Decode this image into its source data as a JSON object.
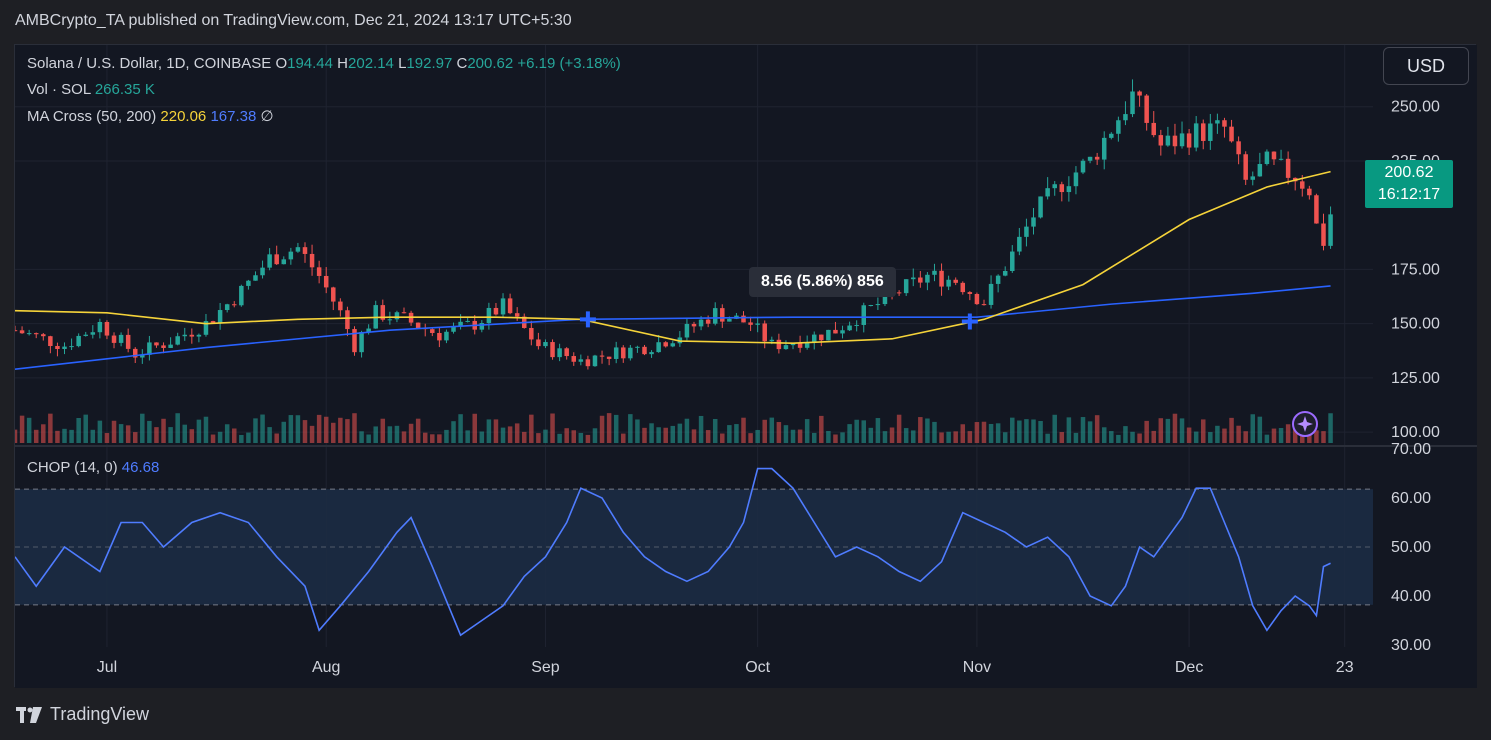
{
  "attribution": "AMBCrypto_TA published on TradingView.com, Dec 21, 2024 13:17 UTC+5:30",
  "legend": {
    "symbol": "Solana / U.S. Dollar, 1D, COINBASE",
    "o_label": "O",
    "o": "194.44",
    "h_label": "H",
    "h": "202.14",
    "l_label": "L",
    "l": "192.97",
    "c_label": "C",
    "c": "200.62",
    "change": "+6.19 (+3.18%)",
    "vol_label": "Vol · SOL",
    "vol": "266.35 K",
    "ma_label": "MA Cross (50, 200)",
    "ma50": "220.06",
    "ma200": "167.38",
    "ma_extra": "∅"
  },
  "currency_button": "USD",
  "price_badge": {
    "price": "200.62",
    "countdown": "16:12:17"
  },
  "measure_tooltip": "8.56 (5.86%) 856",
  "chop_legend": {
    "label": "CHOP (14, 0)",
    "value": "46.68"
  },
  "footer": {
    "brand": "TradingView"
  },
  "colors": {
    "bg": "#131722",
    "up": "#26a69a",
    "down": "#ef5350",
    "ma50": "#f5d33a",
    "ma200": "#2962ff",
    "chop": "#4f7cff",
    "chop_band": "#1c2b44"
  },
  "chart_data": [
    {
      "type": "candlestick",
      "title": "Solana / U.S. Dollar, 1D, COINBASE",
      "y_ticks": [
        "100.00",
        "125.00",
        "150.00",
        "175.00",
        "250.00",
        "225.00"
      ],
      "ylim": [
        95,
        260
      ],
      "x_ticks": [
        "Jul",
        "Aug",
        "Sep",
        "Oct",
        "Nov",
        "Dec",
        "23"
      ],
      "xlim": [
        "2024-06-18",
        "2024-12-27"
      ],
      "close_path": [
        [
          "2024-06-18",
          147
        ],
        [
          "2024-06-25",
          140
        ],
        [
          "2024-06-30",
          150
        ],
        [
          "2024-07-05",
          136
        ],
        [
          "2024-07-10",
          142
        ],
        [
          "2024-07-15",
          150
        ],
        [
          "2024-07-20",
          165
        ],
        [
          "2024-07-24",
          180
        ],
        [
          "2024-07-28",
          185
        ],
        [
          "2024-07-31",
          172
        ],
        [
          "2024-08-03",
          155
        ],
        [
          "2024-08-05",
          140
        ],
        [
          "2024-08-08",
          155
        ],
        [
          "2024-08-12",
          152
        ],
        [
          "2024-08-17",
          145
        ],
        [
          "2024-08-22",
          150
        ],
        [
          "2024-08-26",
          158
        ],
        [
          "2024-08-31",
          140
        ],
        [
          "2024-09-06",
          133
        ],
        [
          "2024-09-10",
          136
        ],
        [
          "2024-09-16",
          140
        ],
        [
          "2024-09-20",
          145
        ],
        [
          "2024-09-25",
          155
        ],
        [
          "2024-09-30",
          150
        ],
        [
          "2024-10-03",
          140
        ],
        [
          "2024-10-08",
          143
        ],
        [
          "2024-10-12",
          147
        ],
        [
          "2024-10-16",
          155
        ],
        [
          "2024-10-21",
          165
        ],
        [
          "2024-10-25",
          172
        ],
        [
          "2024-10-29",
          170
        ],
        [
          "2024-11-02",
          160
        ],
        [
          "2024-11-06",
          182
        ],
        [
          "2024-11-09",
          200
        ],
        [
          "2024-11-13",
          215
        ],
        [
          "2024-11-17",
          225
        ],
        [
          "2024-11-20",
          240
        ],
        [
          "2024-11-23",
          255
        ],
        [
          "2024-11-27",
          232
        ],
        [
          "2024-12-02",
          238
        ],
        [
          "2024-12-06",
          240
        ],
        [
          "2024-12-09",
          215
        ],
        [
          "2024-12-12",
          224
        ],
        [
          "2024-12-16",
          218
        ],
        [
          "2024-12-18",
          212
        ],
        [
          "2024-12-19",
          195
        ],
        [
          "2024-12-20",
          188
        ],
        [
          "2024-12-21",
          200.62
        ]
      ],
      "ma50_path": [
        [
          "2024-06-18",
          156
        ],
        [
          "2024-07-01",
          155
        ],
        [
          "2024-07-15",
          150
        ],
        [
          "2024-07-28",
          152
        ],
        [
          "2024-08-10",
          153
        ],
        [
          "2024-08-25",
          153
        ],
        [
          "2024-09-06",
          152
        ],
        [
          "2024-09-20",
          142
        ],
        [
          "2024-10-06",
          141
        ],
        [
          "2024-10-20",
          143
        ],
        [
          "2024-11-02",
          152
        ],
        [
          "2024-11-16",
          168
        ],
        [
          "2024-12-01",
          198
        ],
        [
          "2024-12-12",
          213
        ],
        [
          "2024-12-21",
          220.06
        ]
      ],
      "ma200_path": [
        [
          "2024-06-18",
          129
        ],
        [
          "2024-07-15",
          139
        ],
        [
          "2024-08-10",
          147
        ],
        [
          "2024-09-06",
          152
        ],
        [
          "2024-10-06",
          153
        ],
        [
          "2024-11-01",
          153
        ],
        [
          "2024-11-20",
          159
        ],
        [
          "2024-12-10",
          164
        ],
        [
          "2024-12-21",
          167.38
        ]
      ],
      "cross_markers": [
        [
          "2024-09-07",
          152
        ],
        [
          "2024-10-31",
          151
        ]
      ]
    },
    {
      "type": "line",
      "title": "CHOP (14, 0)",
      "y_ticks": [
        "70.00",
        "60.00",
        "50.00",
        "40.00",
        "30.00"
      ],
      "ylim": [
        30,
        70
      ],
      "band": [
        38.2,
        61.8
      ],
      "values": [
        [
          "2024-06-18",
          48
        ],
        [
          "2024-06-21",
          42
        ],
        [
          "2024-06-25",
          50
        ],
        [
          "2024-06-30",
          45
        ],
        [
          "2024-07-03",
          55
        ],
        [
          "2024-07-06",
          55
        ],
        [
          "2024-07-09",
          50
        ],
        [
          "2024-07-13",
          55
        ],
        [
          "2024-07-17",
          57
        ],
        [
          "2024-07-21",
          55
        ],
        [
          "2024-07-25",
          48
        ],
        [
          "2024-07-29",
          42
        ],
        [
          "2024-07-31",
          33
        ],
        [
          "2024-08-03",
          38
        ],
        [
          "2024-08-07",
          45
        ],
        [
          "2024-08-11",
          53
        ],
        [
          "2024-08-13",
          56
        ],
        [
          "2024-08-16",
          46
        ],
        [
          "2024-08-20",
          32
        ],
        [
          "2024-08-23",
          35
        ],
        [
          "2024-08-26",
          38
        ],
        [
          "2024-08-29",
          44
        ],
        [
          "2024-09-01",
          48
        ],
        [
          "2024-09-04",
          55
        ],
        [
          "2024-09-06",
          62
        ],
        [
          "2024-09-09",
          60
        ],
        [
          "2024-09-12",
          53
        ],
        [
          "2024-09-15",
          48
        ],
        [
          "2024-09-18",
          45
        ],
        [
          "2024-09-21",
          43
        ],
        [
          "2024-09-24",
          45
        ],
        [
          "2024-09-27",
          50
        ],
        [
          "2024-09-29",
          55
        ],
        [
          "2024-10-01",
          66
        ],
        [
          "2024-10-03",
          66
        ],
        [
          "2024-10-06",
          62
        ],
        [
          "2024-10-09",
          55
        ],
        [
          "2024-10-12",
          48
        ],
        [
          "2024-10-15",
          50
        ],
        [
          "2024-10-18",
          48
        ],
        [
          "2024-10-21",
          45
        ],
        [
          "2024-10-24",
          43
        ],
        [
          "2024-10-27",
          47
        ],
        [
          "2024-10-30",
          57
        ],
        [
          "2024-11-02",
          55
        ],
        [
          "2024-11-05",
          53
        ],
        [
          "2024-11-08",
          50
        ],
        [
          "2024-11-11",
          52
        ],
        [
          "2024-11-14",
          48
        ],
        [
          "2024-11-17",
          40
        ],
        [
          "2024-11-20",
          38
        ],
        [
          "2024-11-22",
          42
        ],
        [
          "2024-11-24",
          50
        ],
        [
          "2024-11-26",
          48
        ],
        [
          "2024-11-28",
          52
        ],
        [
          "2024-11-30",
          56
        ],
        [
          "2024-12-02",
          62
        ],
        [
          "2024-12-04",
          62
        ],
        [
          "2024-12-06",
          55
        ],
        [
          "2024-12-08",
          48
        ],
        [
          "2024-12-10",
          38
        ],
        [
          "2024-12-12",
          33
        ],
        [
          "2024-12-14",
          37
        ],
        [
          "2024-12-16",
          40
        ],
        [
          "2024-12-18",
          38
        ],
        [
          "2024-12-19",
          36
        ],
        [
          "2024-12-20",
          46
        ],
        [
          "2024-12-21",
          46.68
        ]
      ]
    }
  ]
}
